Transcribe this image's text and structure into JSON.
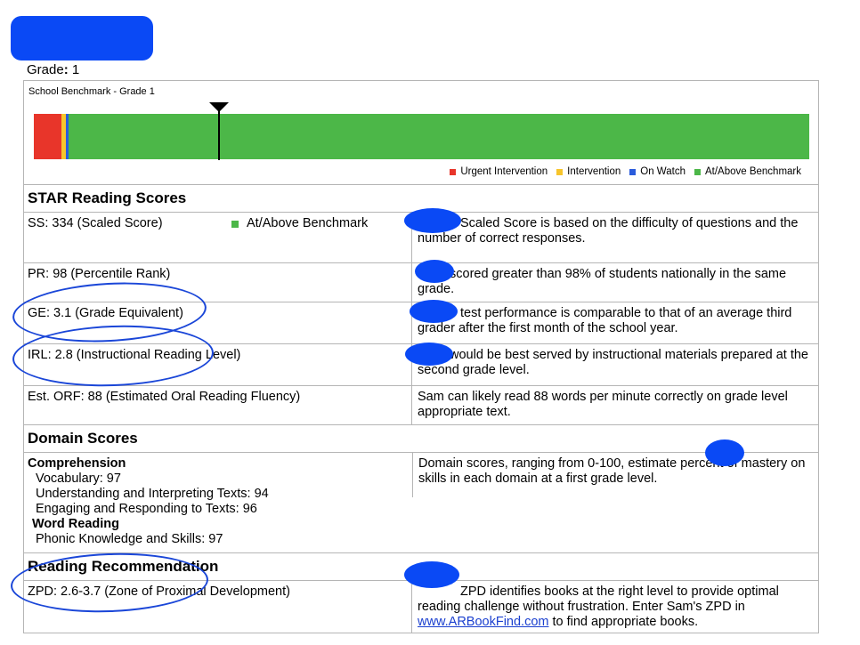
{
  "header": {
    "grade_label": "Grade",
    "grade_value": "1"
  },
  "benchmark": {
    "title": "School Benchmark - Grade 1",
    "legend": [
      {
        "label": "Urgent Intervention",
        "color": "#e8352a"
      },
      {
        "label": "Intervention",
        "color": "#f7c52c"
      },
      {
        "label": "On Watch",
        "color": "#2a5cdc"
      },
      {
        "label": "At/Above Benchmark",
        "color": "#4cb748"
      }
    ]
  },
  "star": {
    "heading": "STAR Reading Scores",
    "rows": [
      {
        "left": "SS: 334 (Scaled Score)",
        "status": "At/Above Benchmark",
        "right": "Scaled Score is based on the difficulty of questions and the number of correct responses."
      },
      {
        "left": "PR: 98 (Percentile Rank)",
        "right": "scored greater than 98% of students nationally in the same grade."
      },
      {
        "left": "GE: 3.1 (Grade Equivalent)",
        "right": "test performance is comparable to that of an average third grader after the first month of the school year."
      },
      {
        "left": "IRL: 2.8 (Instructional Reading Level)",
        "right": "would be best served by instructional materials prepared at the second grade level."
      },
      {
        "left": "Est. ORF: 88 (Estimated Oral Reading Fluency)",
        "right": "Sam can likely read 88 words per minute correctly on grade level appropriate text."
      }
    ]
  },
  "domain": {
    "heading": "Domain Scores",
    "comprehension": "Comprehension",
    "items1": [
      "Vocabulary: 97",
      "Understanding and Interpreting Texts: 94",
      "Engaging and Responding to Texts: 96"
    ],
    "word_reading": "Word Reading",
    "items2": [
      "Phonic Knowledge and Skills: 97"
    ],
    "right": "Domain scores, ranging from 0-100, estimate percent of mastery on skills in each domain at a first grade level."
  },
  "recommendation": {
    "heading": "Reading Recommendation",
    "left": "ZPD: 2.6-3.7 (Zone of Proximal Development)",
    "right_1": "ZPD identifies books at the right level to provide optimal reading challenge without frustration. Enter Sam's ZPD in",
    "link": "www.ARBookFind.com",
    "right_2": "to find appropriate books."
  }
}
